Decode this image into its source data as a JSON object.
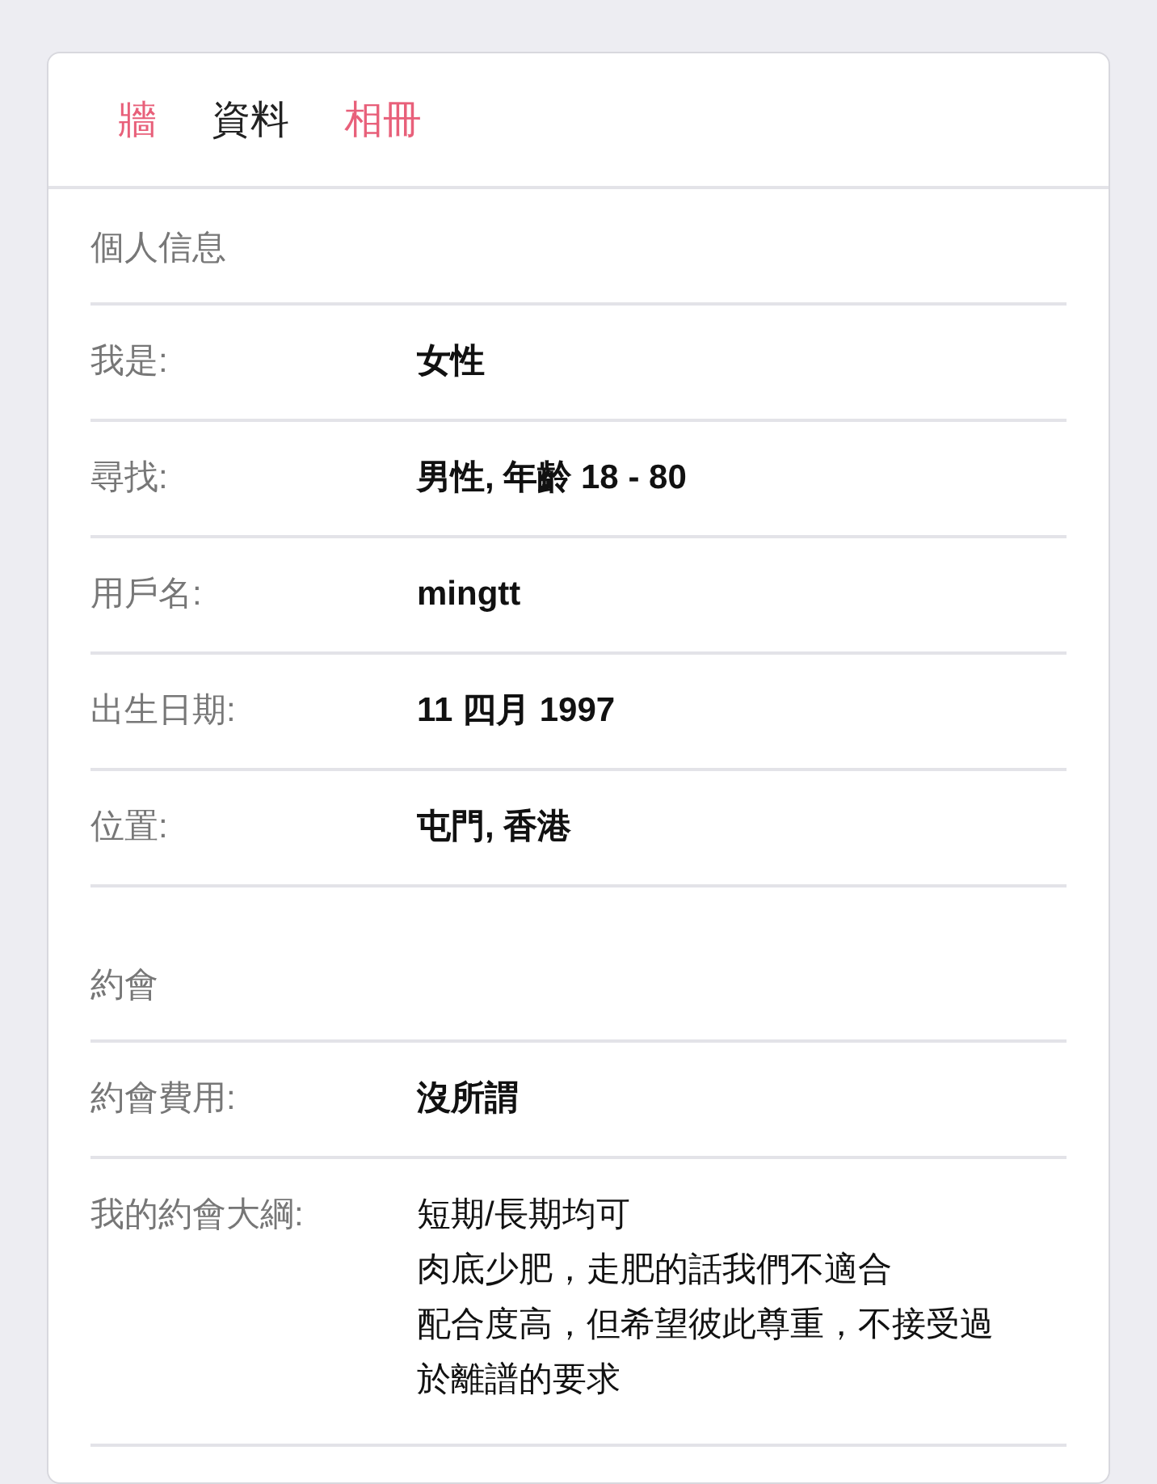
{
  "tabs": [
    {
      "label": "牆",
      "selected": false
    },
    {
      "label": "資料",
      "selected": true
    },
    {
      "label": "相冊",
      "selected": false
    }
  ],
  "sections": [
    {
      "title": "個人信息",
      "rows": [
        {
          "label": "我是:",
          "value": "女性",
          "bold": true
        },
        {
          "label": "尋找:",
          "value": "男性, 年齡 18 - 80",
          "bold": true
        },
        {
          "label": "用戶名:",
          "value": "mingtt",
          "bold": true
        },
        {
          "label": "出生日期:",
          "value": "11 四月 1997",
          "bold": true
        },
        {
          "label": "位置:",
          "value": "屯門, 香港",
          "bold": true
        }
      ]
    },
    {
      "title": "約會",
      "rows": [
        {
          "label": "約會費用:",
          "value": "沒所謂",
          "bold": true
        },
        {
          "label": "我的約會大綱:",
          "lines": [
            "短期/長期均可",
            "肉底少肥，走肥的話我們不適合",
            "配合度高，但希望彼此尊重，不接受過於離譜的要求"
          ],
          "bold": false
        }
      ]
    }
  ]
}
